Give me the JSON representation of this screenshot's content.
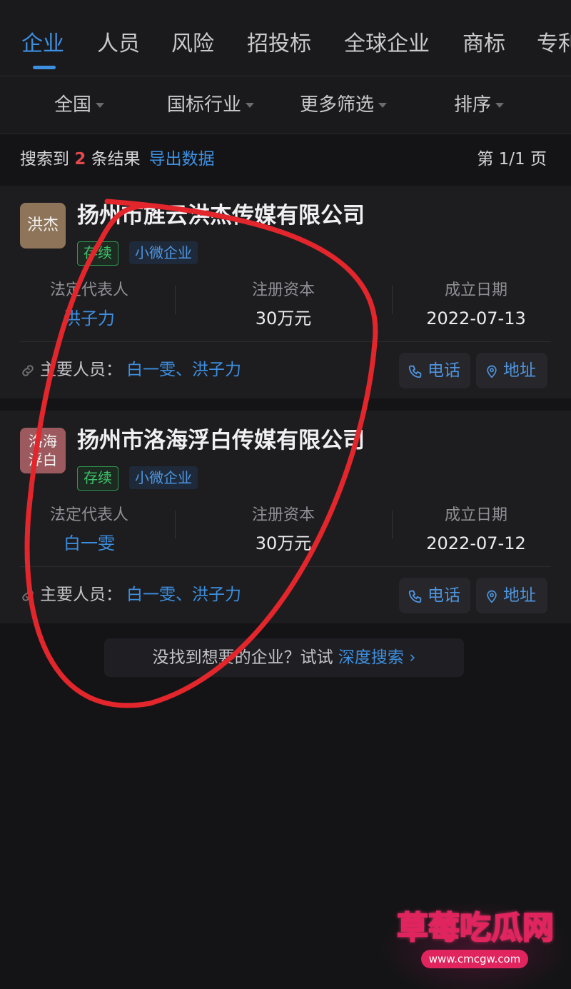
{
  "tabs": [
    "企业",
    "人员",
    "风险",
    "招投标",
    "全球企业",
    "商标",
    "专利"
  ],
  "filters": [
    "全国",
    "国标行业",
    "更多筛选",
    "排序"
  ],
  "results": {
    "prefix": "搜索到",
    "count": "2",
    "suffix": "条结果",
    "export": "导出数据",
    "page": "第 1/1 页"
  },
  "companies": [
    {
      "logo_text": "洪杰",
      "name": "扬州市旌云洪杰传媒有限公司",
      "status": "存续",
      "type": "小微企业",
      "rep_label": "法定代表人",
      "rep": "洪子力",
      "capital_label": "注册资本",
      "capital": "30万元",
      "date_label": "成立日期",
      "date": "2022-07-13",
      "people_label": "主要人员：",
      "people": "白一雯、洪子力",
      "phone": "电话",
      "address": "地址"
    },
    {
      "logo_text": "洛海浮白",
      "name": "扬州市洛海浮白传媒有限公司",
      "status": "存续",
      "type": "小微企业",
      "rep_label": "法定代表人",
      "rep": "白一雯",
      "capital_label": "注册资本",
      "capital": "30万元",
      "date_label": "成立日期",
      "date": "2022-07-12",
      "people_label": "主要人员：",
      "people": "白一雯、洪子力",
      "phone": "电话",
      "address": "地址"
    }
  ],
  "deep_search": {
    "text": "没找到想要的企业？试试",
    "link": "深度搜索 ›"
  },
  "watermark": {
    "title": "草莓吃瓜网",
    "url": "www.cmcgw.com"
  },
  "colors": {
    "accent": "#3d8fe0",
    "status_green": "#3fc26a",
    "count_red": "#e5484d",
    "annotation_red": "#e3262c",
    "background": "#141416",
    "card": "#1d1d20"
  },
  "icons": [
    "link-icon",
    "phone-icon",
    "location-pin-icon",
    "chevron-right-icon",
    "caret-down-icon"
  ]
}
